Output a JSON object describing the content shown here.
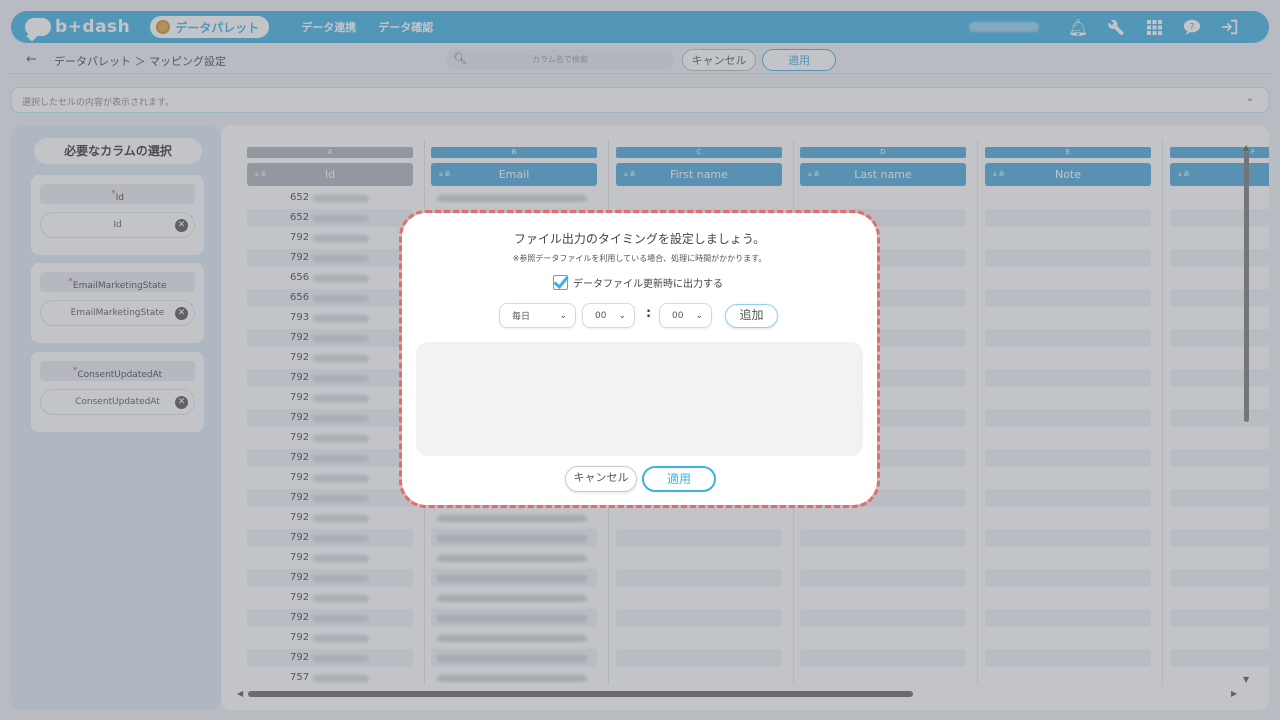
{
  "header": {
    "logo": "b+dash",
    "active_nav": "データパレット",
    "nav": [
      "データ連携",
      "データ確認"
    ]
  },
  "subheader": {
    "breadcrumb": "データパレット ＞ マッピング設定",
    "search_placeholder": "カラム名で検索",
    "cancel": "キャンセル",
    "apply": "適用"
  },
  "cellbar": {
    "text": "選択したセルの内容が表示されます。"
  },
  "left_panel": {
    "title": "必要なカラムの選択",
    "required_mark": "*",
    "cards": [
      {
        "label": "Id",
        "value": "Id"
      },
      {
        "label": "EmailMarketingState",
        "value": "EmailMarketingState"
      },
      {
        "label": "ConsentUpdatedAt",
        "value": "ConsentUpdatedAt"
      }
    ]
  },
  "grid": {
    "columns": [
      {
        "letter": "A",
        "name": "Id"
      },
      {
        "letter": "B",
        "name": "Email"
      },
      {
        "letter": "C",
        "name": "First name"
      },
      {
        "letter": "D",
        "name": "Last name"
      },
      {
        "letter": "E",
        "name": "Note"
      },
      {
        "letter": "F",
        "name": ""
      }
    ],
    "type_tag": "a あ",
    "id_values": [
      "652",
      "652",
      "792",
      "792",
      "656",
      "656",
      "793",
      "792",
      "792",
      "792",
      "792",
      "792",
      "792",
      "792",
      "792",
      "792",
      "792",
      "792",
      "792",
      "792",
      "792",
      "792",
      "792",
      "792",
      "757"
    ]
  },
  "modal": {
    "title": "ファイル出力のタイミングを設定しましょう。",
    "note": "※参照データファイルを利用している場合、処理に時間がかかります。",
    "checkbox_label": "データファイル更新時に出力する",
    "checkbox_checked": true,
    "frequency": "毎日",
    "hour": "00",
    "minute": "00",
    "separator": ":",
    "add": "追加",
    "cancel": "キャンセル",
    "apply": "適用"
  },
  "colors": {
    "brand": "#3fb0e4",
    "highlight_outline": "#e86a6a"
  }
}
